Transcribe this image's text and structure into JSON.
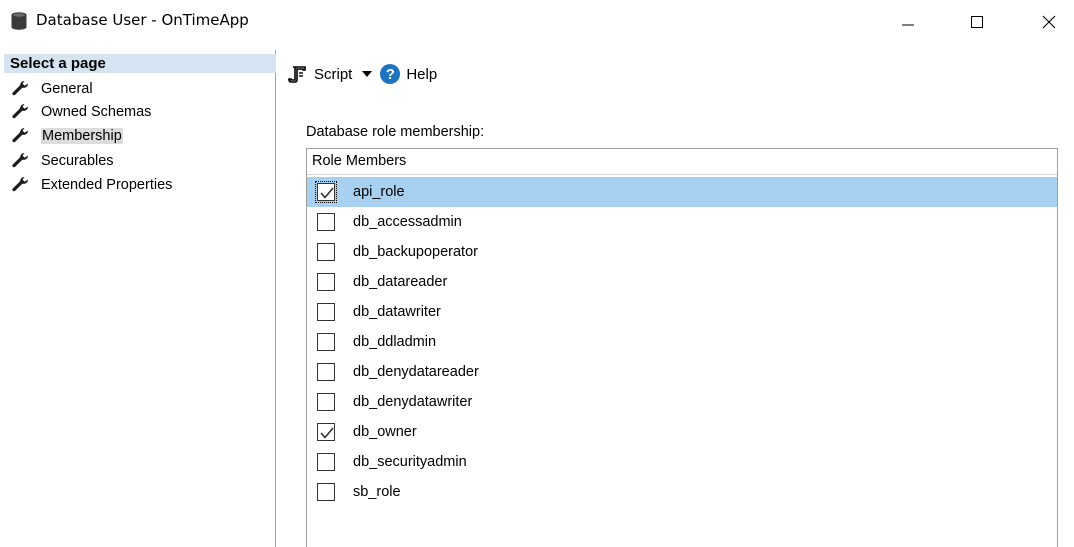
{
  "window": {
    "title": "Database User - OnTimeApp",
    "minimize_icon": "minimize-icon",
    "maximize_icon": "maximize-icon",
    "close_icon": "close-icon"
  },
  "left_pane": {
    "header": "Select a page",
    "items": [
      {
        "label": "General",
        "icon": "wrench-icon"
      },
      {
        "label": "Owned Schemas",
        "icon": "wrench-icon"
      },
      {
        "label": "Membership",
        "icon": "wrench-icon",
        "selected": true
      },
      {
        "label": "Securables",
        "icon": "wrench-icon"
      },
      {
        "label": "Extended Properties",
        "icon": "wrench-icon"
      }
    ]
  },
  "toolbar": {
    "script_label": "Script",
    "help_label": "Help",
    "help_glyph": "?"
  },
  "membership": {
    "section_label": "Database role membership:",
    "column_header": "Role Members",
    "roles": [
      {
        "name": "api_role",
        "checked": true,
        "selected": true
      },
      {
        "name": "db_accessadmin",
        "checked": false
      },
      {
        "name": "db_backupoperator",
        "checked": false
      },
      {
        "name": "db_datareader",
        "checked": false
      },
      {
        "name": "db_datawriter",
        "checked": false
      },
      {
        "name": "db_ddladmin",
        "checked": false
      },
      {
        "name": "db_denydatareader",
        "checked": false
      },
      {
        "name": "db_denydatawriter",
        "checked": false
      },
      {
        "name": "db_owner",
        "checked": true
      },
      {
        "name": "db_securityadmin",
        "checked": false
      },
      {
        "name": "sb_role",
        "checked": false
      }
    ]
  },
  "colors": {
    "selection": "#a8d0f1",
    "header_band": "#d6e3f0",
    "help_blue": "#1e73be"
  }
}
